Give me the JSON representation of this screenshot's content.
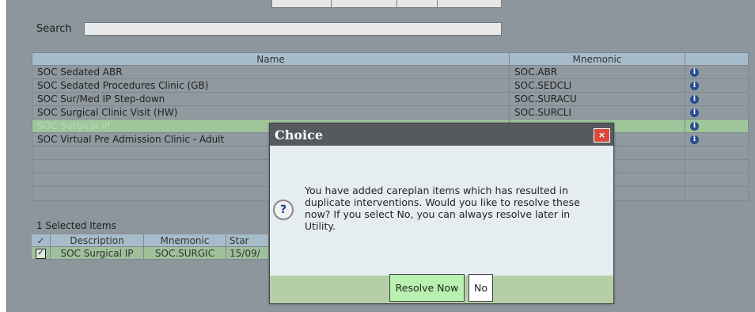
{
  "search": {
    "label": "Search",
    "value": ""
  },
  "grid": {
    "headers": [
      "Name",
      "Mnemonic",
      ""
    ],
    "rows": [
      {
        "name": "SOC Sedated ABR",
        "mnemonic": "SOC.ABR"
      },
      {
        "name": "SOC Sedated Procedures Clinic (GB)",
        "mnemonic": "SOC.SEDCLI"
      },
      {
        "name": "SOC Sur/Med IP Step-down",
        "mnemonic": "SOC.SURACU"
      },
      {
        "name": "SOC Surgical Clinic Visit (HW)",
        "mnemonic": "SOC.SURCLI"
      },
      {
        "name": "SOC Surgical IP",
        "mnemonic": ""
      },
      {
        "name": "SOC Virtual Pre Admission Clinic - Adult",
        "mnemonic": ""
      }
    ],
    "info_icon": "i"
  },
  "selected": {
    "title": "1 Selected Items",
    "headers": {
      "check": "✓",
      "description": "Description",
      "mnemonic": "Mnemonic",
      "start": "Star"
    },
    "rows": [
      {
        "check": "✓",
        "description": "SOC Surgical IP",
        "mnemonic": "SOC.SURGIC",
        "start": "15/09/"
      }
    ]
  },
  "dialog": {
    "title": "Choice",
    "close": "×",
    "question_icon": "?",
    "message": "You have added careplan items which has resulted in duplicate interventions.  Would you like to resolve these now?  If you select No, you can always resolve later in Utility.",
    "resolve_label": "Resolve Now",
    "no_label": "No"
  },
  "colors": {
    "selected_row": "#9fc59a",
    "header": "#a7bccb",
    "dialog_footer": "#b4cfa8",
    "close": "#d94a3c"
  }
}
